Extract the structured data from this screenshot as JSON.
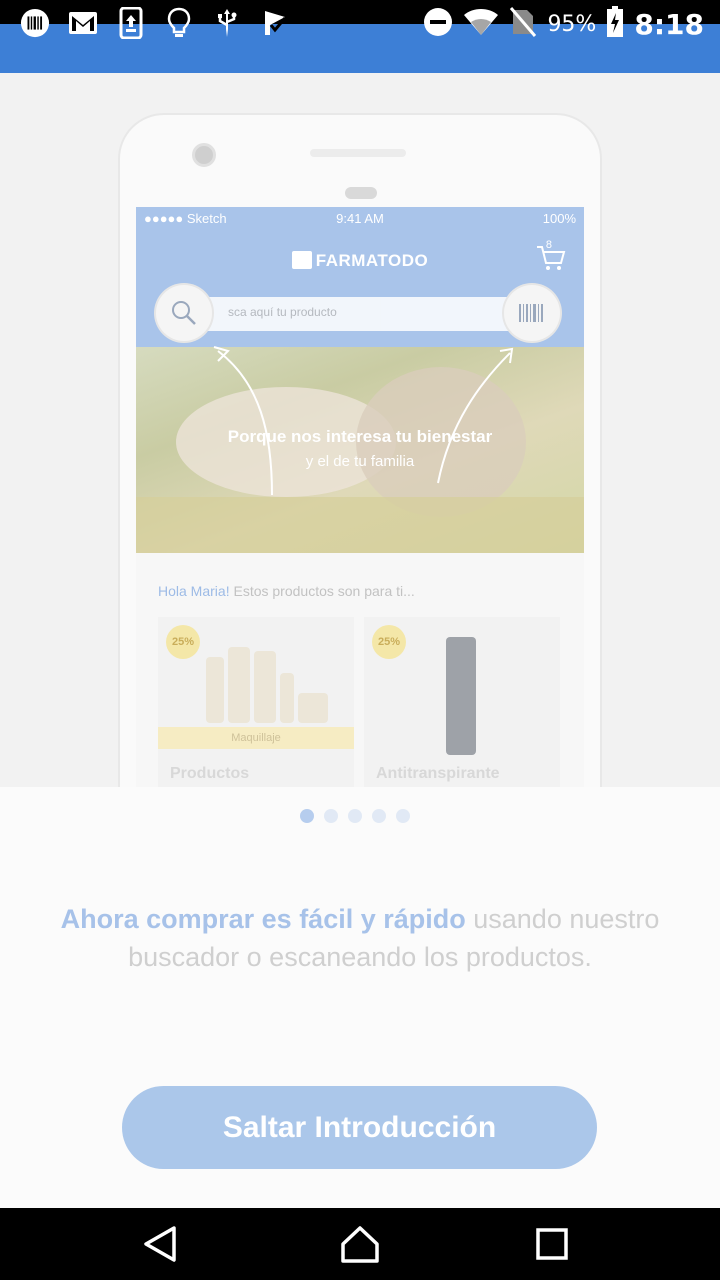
{
  "status_bar": {
    "icons": [
      "barcode-icon",
      "gmail-icon",
      "upload-icon",
      "lightbulb-icon",
      "usb-icon",
      "check-flag-icon",
      "do-not-disturb-icon",
      "wifi-icon",
      "no-sim-icon",
      "battery-icon"
    ],
    "battery": "95%",
    "time": "8:18"
  },
  "illustration": {
    "mock_status_left": "●●●●● Sketch",
    "mock_status_time": "9:41 AM",
    "mock_status_right": "100%",
    "brand": "FARMATODO",
    "cart_count": "8",
    "search_placeholder": "sca aquí tu producto",
    "hero_line1": "Porque nos interesa tu bienestar",
    "hero_line2": "y el de tu familia",
    "greeting_name": "Hola Maria!",
    "greeting_rest": " Estos productos son para ti...",
    "cards": [
      {
        "badge": "25%",
        "strip": "Maquillaje",
        "name": "Productos"
      },
      {
        "badge": "25%",
        "strip": "",
        "name": "Antitranspirante"
      }
    ]
  },
  "pager": {
    "count": 5,
    "active": 0
  },
  "message": {
    "highlight": "Ahora comprar es fácil y rápido",
    "rest": " usando nuestro buscador o escaneando los productos."
  },
  "skip_button": {
    "label": "Saltar Introducción"
  },
  "colors": {
    "primary": "#3d7fd6",
    "button": "#abc7ea",
    "highlight": "#a7c2e9"
  }
}
